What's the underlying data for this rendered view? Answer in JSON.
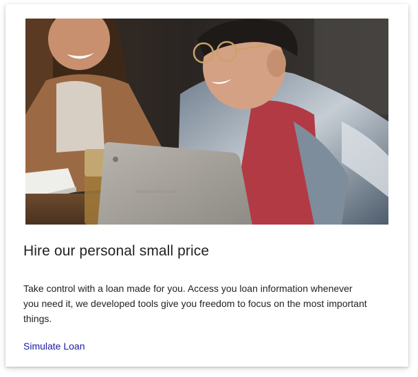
{
  "card": {
    "image_alt": "Two people laughing in front of a laptop",
    "title": "Hire our personal small price",
    "description": "Take control with a loan made for you. Access you loan information whenever you need it, we developed tools give you freedom to focus on the most important things.",
    "cta_label": "Simulate Loan"
  },
  "colors": {
    "title_text": "#222222",
    "body_text": "#222222",
    "link": "#1a1aa6",
    "card_background": "#ffffff"
  }
}
